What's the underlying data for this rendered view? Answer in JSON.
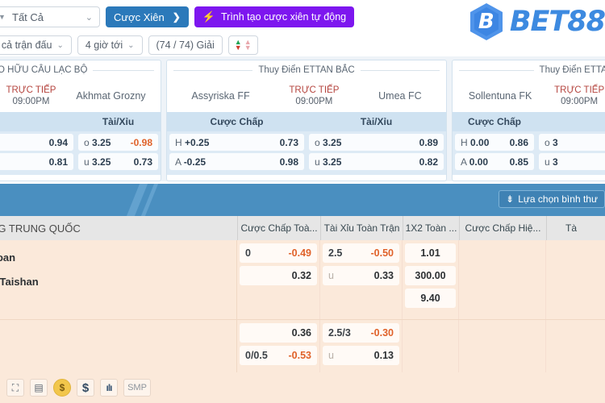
{
  "topbar": {
    "select_all": "Tất Cả",
    "parlay_button": "Cược Xiên",
    "parlay_arrow": "❯",
    "auto_parlay_button": "Trình tạo cược xiên tự động",
    "auto_icon": "⚡",
    "logo_mark": "B",
    "logo_text": "BET88",
    "filters": [
      {
        "label": "ất cả trận đấu",
        "chev": "⌄"
      },
      {
        "label": "4 giờ tới",
        "chev": "⌄"
      },
      {
        "label": "(74 / 74) Giải",
        "chev": ""
      }
    ],
    "sort_icon": "sort-arrows"
  },
  "match_cards": [
    {
      "league": "O HỮU CÂU LẠC BỘ",
      "home": "",
      "away": "Akhmat Grozny",
      "live_label": "TRỰC TIẾP",
      "time": "09:00PM",
      "markets": [
        {
          "title": "",
          "rows": [
            {
              "label": "",
              "bold": "",
              "value": "0.94",
              "neg": false
            },
            {
              "label": "",
              "bold": "",
              "value": "0.81",
              "neg": false
            }
          ]
        },
        {
          "title": "Tài/Xỉu",
          "rows": [
            {
              "label": "o",
              "bold": "3.25",
              "value": "-0.98",
              "neg": true
            },
            {
              "label": "u",
              "bold": "3.25",
              "value": "0.73",
              "neg": false
            }
          ]
        }
      ]
    },
    {
      "league": "Thuy Điển ETTAN BẮC",
      "home": "Assyriska FF",
      "away": "Umea FC",
      "live_label": "TRỰC TIẾP",
      "time": "09:00PM",
      "markets": [
        {
          "title": "Cược Chấp",
          "rows": [
            {
              "label": "H",
              "bold": "+0.25",
              "value": "0.73",
              "neg": false
            },
            {
              "label": "A",
              "bold": "-0.25",
              "value": "0.98",
              "neg": false
            }
          ]
        },
        {
          "title": "Tài/Xỉu",
          "rows": [
            {
              "label": "o",
              "bold": "3.25",
              "value": "0.89",
              "neg": false
            },
            {
              "label": "u",
              "bold": "3.25",
              "value": "0.82",
              "neg": false
            }
          ]
        }
      ]
    },
    {
      "league": "Thuy Điển ETTAN",
      "home": "Sollentuna FK",
      "away": "",
      "live_label": "TRỰC TIẾP",
      "time": "09:00PM",
      "markets": [
        {
          "title": "Cược Chấp",
          "rows": [
            {
              "label": "H",
              "bold": "0.00",
              "value": "0.86",
              "neg": false
            },
            {
              "label": "A",
              "bold": "0.00",
              "value": "0.85",
              "neg": false
            }
          ]
        },
        {
          "title": "",
          "rows": [
            {
              "label": "o",
              "bold": "3",
              "value": "",
              "neg": false
            },
            {
              "label": "u",
              "bold": "3",
              "value": "",
              "neg": false
            }
          ]
        }
      ]
    }
  ],
  "banner": {
    "normal_select_label": "Lựa chọn bình thư",
    "normal_select_icon": "⇟"
  },
  "table": {
    "league_header": "NG TRUNG QUỐC",
    "columns": [
      "Cược Chấp Toà...",
      "Tài Xỉu Toàn Trận",
      "1X2 Toàn ...",
      "Cược Chấp Hiệ...",
      "Tà"
    ],
    "rows": [
      {
        "teams": [
          "uoan",
          "g Taishan"
        ],
        "handicap": [
          {
            "hcap": "0",
            "value": "-0.49",
            "neg": true
          },
          {
            "hcap": "",
            "value": "0.32",
            "neg": false
          },
          {
            "hcap": "",
            "value": "",
            "blank": true
          }
        ],
        "overunder": [
          {
            "hcap": "2.5",
            "value": "-0.50",
            "neg": true,
            "dim": false
          },
          {
            "hcap": "u",
            "value": "0.33",
            "neg": false,
            "dim": true
          },
          {
            "hcap": "",
            "value": "",
            "blank": true
          }
        ],
        "onextwo": [
          {
            "value": "1.01"
          },
          {
            "value": "300.00"
          },
          {
            "value": "9.40"
          }
        ]
      },
      {
        "teams": [
          "",
          ""
        ],
        "handicap": [
          {
            "hcap": "",
            "value": "0.36",
            "neg": false
          },
          {
            "hcap": "0/0.5",
            "value": "-0.53",
            "neg": true
          }
        ],
        "overunder": [
          {
            "hcap": "2.5/3",
            "value": "-0.30",
            "neg": true,
            "dim": false
          },
          {
            "hcap": "u",
            "value": "0.13",
            "neg": false,
            "dim": true
          }
        ],
        "onextwo": []
      }
    ]
  },
  "bottom_toolbar": [
    {
      "icon": "⛶",
      "name": "field-icon",
      "label": ""
    },
    {
      "icon": "▤",
      "name": "stack-icon",
      "label": ""
    },
    {
      "icon": "$",
      "name": "coin-icon",
      "label": ""
    },
    {
      "icon": "$",
      "name": "dollar-icon",
      "label": ""
    },
    {
      "icon": "ıIı",
      "name": "bars-icon",
      "label": ""
    },
    {
      "icon": "",
      "name": "smp-icon",
      "label": "SMP"
    }
  ],
  "colors": {
    "brand_blue": "#3d8ae0",
    "banner_blue": "#4a8fc0",
    "purple": "#7d16ef",
    "table_peach": "#fbe9da",
    "negative_orange": "#e0622a",
    "live_red": "#b5453f"
  }
}
